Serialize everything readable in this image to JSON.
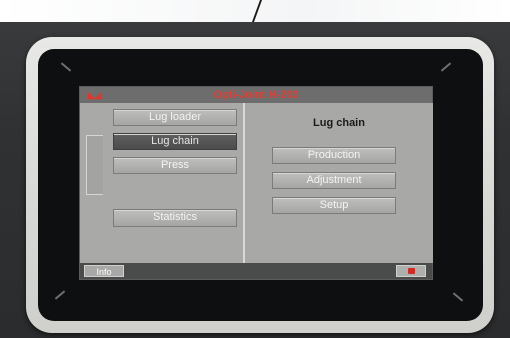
{
  "window": {
    "title": "Opti-Joint H-200",
    "logo_icon": "brand-logo-icon"
  },
  "left_menu": {
    "items": [
      {
        "label": "Lug loader",
        "active": false
      },
      {
        "label": "Lug chain",
        "active": true
      },
      {
        "label": "Press",
        "active": false
      },
      {
        "label": "Statistics",
        "active": false
      }
    ]
  },
  "right_panel": {
    "heading": "Lug chain",
    "buttons": [
      {
        "label": "Production"
      },
      {
        "label": "Adjustment"
      },
      {
        "label": "Setup"
      }
    ]
  },
  "status_bar": {
    "info_label": "Info",
    "stop_icon": "stop-icon"
  },
  "colors": {
    "title_text": "#e33c32",
    "screen_bg": "#a7a8a6",
    "active_button": "#4b4c4b",
    "stop_red": "#d42a24"
  }
}
